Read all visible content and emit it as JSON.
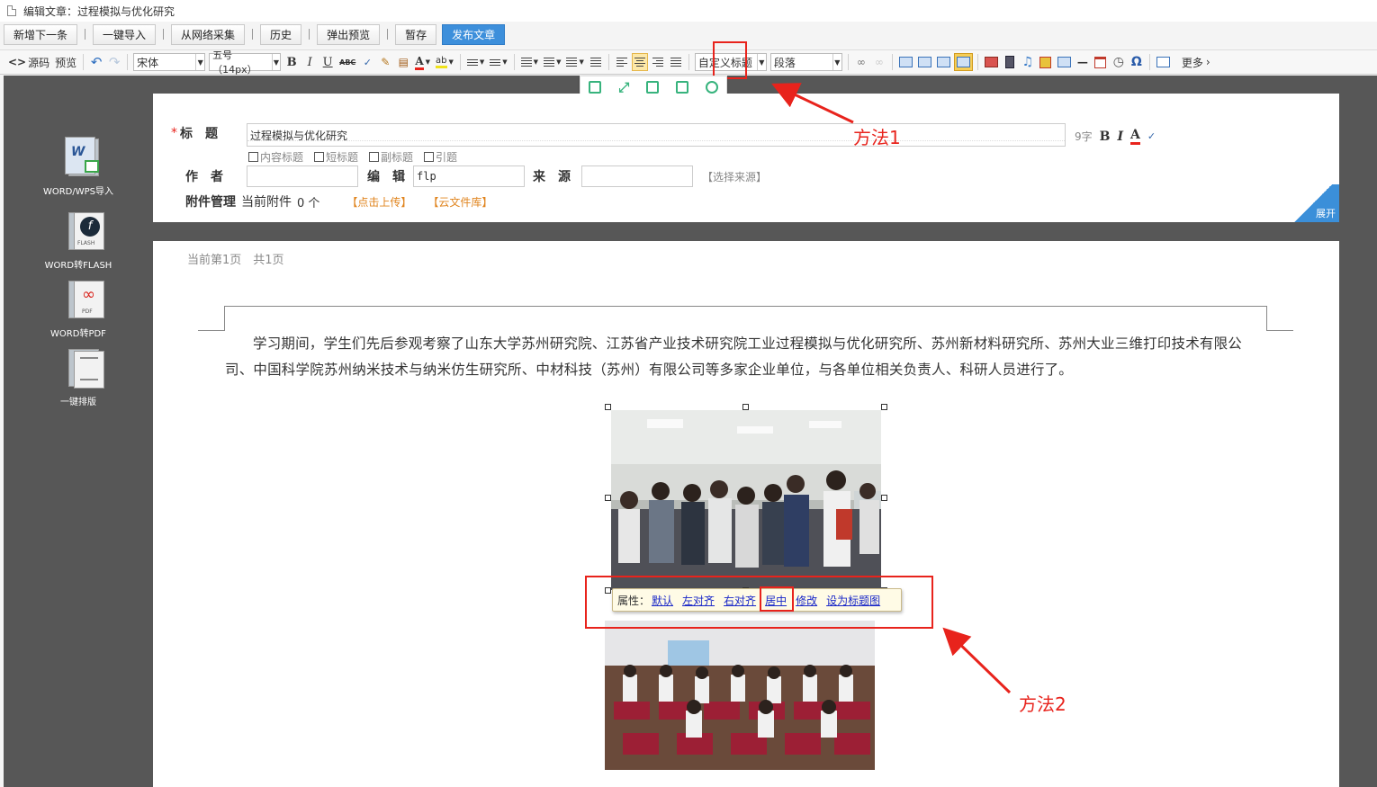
{
  "window": {
    "title": "编辑文章：过程模拟与优化研究"
  },
  "actions": [
    "新增下一条",
    "一键导入",
    "从网络采集",
    "历史",
    "弹出预览",
    "暂存",
    "发布文章"
  ],
  "toolbar": {
    "source": "源码",
    "preview": "预览",
    "font_family": "宋体",
    "font_size": "五号（14px）",
    "heading": "自定义标题",
    "paragraph": "段落",
    "more": "更多",
    "bold": "B",
    "italic": "I",
    "underline": "U",
    "strike": "ABC",
    "omega": "Ω"
  },
  "form": {
    "title_label": "标　题",
    "title_value": "过程模拟与优化研究",
    "char_count": "9字",
    "checkboxes": [
      "内容标题",
      "短标题",
      "副标题",
      "引题"
    ],
    "author_label": "作　者",
    "editor_label": "编　辑",
    "editor_value": "flp",
    "source_label": "来　源",
    "source_select": "【选择来源】",
    "attach_label": "附件管理",
    "attach_current": "当前附件",
    "attach_count": "0 个",
    "upload": "【点击上传】",
    "cloud": "【云文件库】",
    "expand": "展开"
  },
  "sidebar": [
    {
      "label": "WORD/WPS导入"
    },
    {
      "label": "WORD转FLASH"
    },
    {
      "label": "WORD转PDF"
    },
    {
      "label": "一键排版"
    }
  ],
  "document": {
    "page_info": "当前第1页　共1页",
    "paragraph": "学习期间，学生们先后参观考察了山东大学苏州研究院、江苏省产业技术研究院工业过程模拟与优化研究所、苏州新材料研究所、苏州大业三维打印技术有限公司、中国科学院苏州纳米技术与纳米仿生研究所、中材科技（苏州）有限公司等多家企业单位，与各单位相关负责人、科研人员进行了。"
  },
  "image_props": {
    "label": "属性：",
    "options": [
      "默认",
      "左对齐",
      "右对齐",
      "居中",
      "修改",
      "设为标题图"
    ]
  },
  "annotations": {
    "method1": "方法1",
    "method2": "方法2"
  },
  "colors": {
    "accent": "#3d8fdb",
    "annotation": "#e8231c",
    "link": "#1a28c8"
  }
}
